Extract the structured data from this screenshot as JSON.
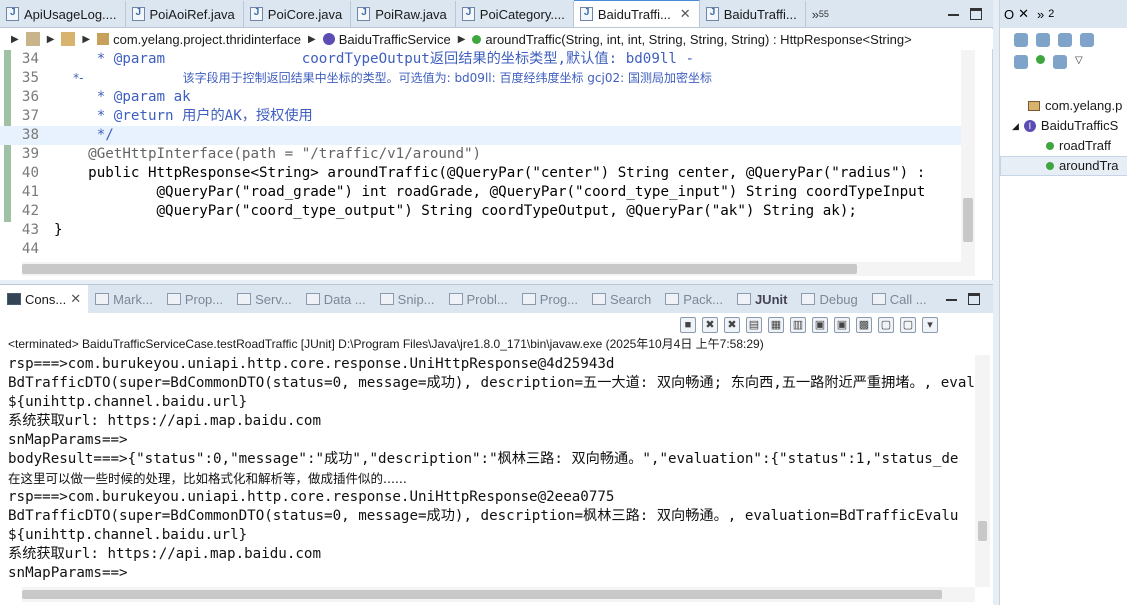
{
  "editor": {
    "tabs": [
      {
        "label": "ApiUsageLog....",
        "active": false,
        "icon": "java-file-icon"
      },
      {
        "label": "PoiAoiRef.java",
        "active": false,
        "icon": "java-file-icon"
      },
      {
        "label": "PoiCore.java",
        "active": false,
        "icon": "java-file-icon"
      },
      {
        "label": "PoiRaw.java",
        "active": false,
        "icon": "java-file-icon"
      },
      {
        "label": "PoiCategory....",
        "active": false,
        "icon": "java-file-icon"
      },
      {
        "label": "BaiduTraffi...",
        "active": true,
        "icon": "java-file-icon"
      },
      {
        "label": "BaiduTraffi...",
        "active": false,
        "icon": "java-file-icon"
      }
    ],
    "tab_overflow": "»",
    "tab_overflow_count": "55",
    "breadcrumb": {
      "package": "com.yelang.project.thridinterface",
      "type": "BaiduTrafficService",
      "method": "aroundTraffic(String, int, int, String, String, String) : HttpResponse<String>"
    },
    "lines": [
      {
        "num": "34",
        "text": "     * @param                coordTypeOutput返回结果的坐标类型,默认值: bd09ll -"
      },
      {
        "num": "35",
        "text": "     *-                          该字段用于控制返回结果中坐标的类型。可选值为: bd09ll: 百度经纬度坐标 gcj02: 国测局加密坐标"
      },
      {
        "num": "36",
        "text": "     * @param ak"
      },
      {
        "num": "37",
        "text": "     * @return 用户的AK，授权使用"
      },
      {
        "num": "38",
        "text": "     */"
      },
      {
        "num": "39",
        "text": "    @GetHttpInterface(path = \"/traffic/v1/around\")"
      },
      {
        "num": "40",
        "text": "    public HttpResponse<String> aroundTraffic(@QueryPar(\"center\") String center, @QueryPar(\"radius\") :"
      },
      {
        "num": "41",
        "text": "            @QueryPar(\"road_grade\") int roadGrade, @QueryPar(\"coord_type_input\") String coordTypeInput"
      },
      {
        "num": "42",
        "text": "            @QueryPar(\"coord_type_output\") String coordTypeOutput, @QueryPar(\"ak\") String ak);"
      },
      {
        "num": "43",
        "text": "}"
      },
      {
        "num": "44",
        "text": ""
      }
    ]
  },
  "console": {
    "tabs": [
      {
        "label": "Cons...",
        "active": true
      },
      {
        "label": "Mark...",
        "active": false
      },
      {
        "label": "Prop...",
        "active": false
      },
      {
        "label": "Serv...",
        "active": false
      },
      {
        "label": "Data ...",
        "active": false
      },
      {
        "label": "Snip...",
        "active": false
      },
      {
        "label": "Probl...",
        "active": false
      },
      {
        "label": "Prog...",
        "active": false
      },
      {
        "label": "Search",
        "active": false
      },
      {
        "label": "Pack...",
        "active": false
      },
      {
        "label": "JUnit",
        "active": false
      },
      {
        "label": "Debug",
        "active": false
      },
      {
        "label": "Call ...",
        "active": false
      }
    ],
    "terminated": "<terminated> BaiduTrafficServiceCase.testRoadTraffic [JUnit] D:\\Program Files\\Java\\jre1.8.0_171\\bin\\javaw.exe  (2025年10月4日 上午7:58:29)",
    "output": [
      "rsp===>com.burukeyou.uniapi.http.core.response.UniHttpResponse@4d25943d",
      "BdTrafficDTO(super=BdCommonDTO(status=0, message=成功), description=五一大道: 双向畅通; 东向西,五一路附近严重拥堵。, evaluat",
      "${unihttp.channel.baidu.url}",
      "系统获取url: https://api.map.baidu.com",
      "snMapParams==>",
      "bodyResult===>{\"status\":0,\"message\":\"成功\",\"description\":\"枫林三路: 双向畅通。\",\"evaluation\":{\"status\":1,\"status_de",
      "在这里可以做一些时候的处理，比如格式化和解析等，做成插件似的......",
      "rsp===>com.burukeyou.uniapi.http.core.response.UniHttpResponse@2eea0775",
      "BdTrafficDTO(super=BdCommonDTO(status=0, message=成功), description=枫林三路: 双向畅通。, evaluation=BdTrafficEvalu",
      "${unihttp.channel.baidu.url}",
      "系统获取url: https://api.map.baidu.com",
      "snMapParams==>"
    ]
  },
  "outline": {
    "tabs": [
      {
        "label": "O",
        "active": true
      },
      {
        "label": "»",
        "sub": "2",
        "active": false
      }
    ],
    "items": [
      {
        "label": "com.yelang.p",
        "kind": "package",
        "indent": 1
      },
      {
        "label": "BaiduTrafficS",
        "kind": "interface",
        "indent": 0,
        "expanded": true
      },
      {
        "label": "roadTraff",
        "kind": "method",
        "indent": 2
      },
      {
        "label": "aroundTra",
        "kind": "method",
        "indent": 2,
        "selected": true
      }
    ]
  },
  "colors": {
    "comment": "#3f5fbf",
    "keyword": "#7f0055",
    "string": "#2a00ff",
    "annotation": "#646464",
    "tab_bar": "#dce6f1"
  }
}
